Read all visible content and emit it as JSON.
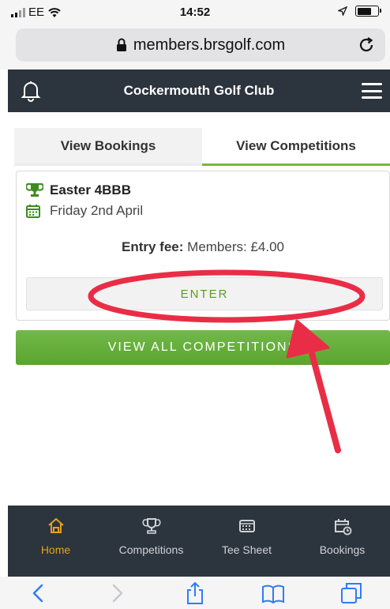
{
  "status_bar": {
    "carrier": "EE",
    "time": "14:52"
  },
  "browser": {
    "url": "members.brsgolf.com"
  },
  "header": {
    "title": "Cockermouth Golf Club"
  },
  "tabs": [
    {
      "label": "View Bookings",
      "active": false
    },
    {
      "label": "View Competitions",
      "active": true
    }
  ],
  "competition": {
    "name": "Easter 4BBB",
    "date": "Friday 2nd April",
    "fee_label": "Entry fee:",
    "fee_value": "Members: £4.00",
    "enter_label": "ENTER"
  },
  "view_all_label": "VIEW ALL COMPETITIONS",
  "bottom_nav": [
    {
      "label": "Home",
      "icon": "home-icon",
      "active": true
    },
    {
      "label": "Competitions",
      "icon": "trophy-icon",
      "active": false
    },
    {
      "label": "Tee Sheet",
      "icon": "tee-sheet-icon",
      "active": false
    },
    {
      "label": "Bookings",
      "icon": "calendar-clock-icon",
      "active": false
    }
  ],
  "colors": {
    "header_bg": "#2c343e",
    "accent_green": "#5aa52e",
    "active_nav": "#e4a11b",
    "annotation_red": "#ea2d46"
  }
}
